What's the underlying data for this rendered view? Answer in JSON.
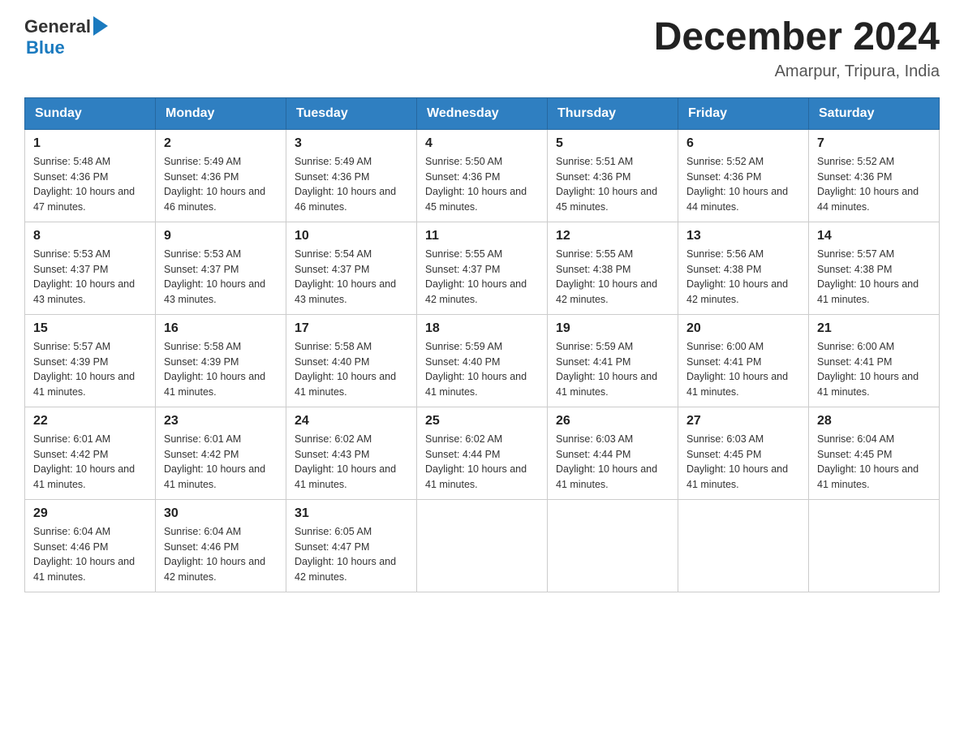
{
  "header": {
    "logo_general": "General",
    "logo_blue": "Blue",
    "month_title": "December 2024",
    "location": "Amarpur, Tripura, India"
  },
  "days_of_week": [
    "Sunday",
    "Monday",
    "Tuesday",
    "Wednesday",
    "Thursday",
    "Friday",
    "Saturday"
  ],
  "weeks": [
    [
      {
        "day": "1",
        "sunrise": "5:48 AM",
        "sunset": "4:36 PM",
        "daylight": "10 hours and 47 minutes."
      },
      {
        "day": "2",
        "sunrise": "5:49 AM",
        "sunset": "4:36 PM",
        "daylight": "10 hours and 46 minutes."
      },
      {
        "day": "3",
        "sunrise": "5:49 AM",
        "sunset": "4:36 PM",
        "daylight": "10 hours and 46 minutes."
      },
      {
        "day": "4",
        "sunrise": "5:50 AM",
        "sunset": "4:36 PM",
        "daylight": "10 hours and 45 minutes."
      },
      {
        "day": "5",
        "sunrise": "5:51 AM",
        "sunset": "4:36 PM",
        "daylight": "10 hours and 45 minutes."
      },
      {
        "day": "6",
        "sunrise": "5:52 AM",
        "sunset": "4:36 PM",
        "daylight": "10 hours and 44 minutes."
      },
      {
        "day": "7",
        "sunrise": "5:52 AM",
        "sunset": "4:36 PM",
        "daylight": "10 hours and 44 minutes."
      }
    ],
    [
      {
        "day": "8",
        "sunrise": "5:53 AM",
        "sunset": "4:37 PM",
        "daylight": "10 hours and 43 minutes."
      },
      {
        "day": "9",
        "sunrise": "5:53 AM",
        "sunset": "4:37 PM",
        "daylight": "10 hours and 43 minutes."
      },
      {
        "day": "10",
        "sunrise": "5:54 AM",
        "sunset": "4:37 PM",
        "daylight": "10 hours and 43 minutes."
      },
      {
        "day": "11",
        "sunrise": "5:55 AM",
        "sunset": "4:37 PM",
        "daylight": "10 hours and 42 minutes."
      },
      {
        "day": "12",
        "sunrise": "5:55 AM",
        "sunset": "4:38 PM",
        "daylight": "10 hours and 42 minutes."
      },
      {
        "day": "13",
        "sunrise": "5:56 AM",
        "sunset": "4:38 PM",
        "daylight": "10 hours and 42 minutes."
      },
      {
        "day": "14",
        "sunrise": "5:57 AM",
        "sunset": "4:38 PM",
        "daylight": "10 hours and 41 minutes."
      }
    ],
    [
      {
        "day": "15",
        "sunrise": "5:57 AM",
        "sunset": "4:39 PM",
        "daylight": "10 hours and 41 minutes."
      },
      {
        "day": "16",
        "sunrise": "5:58 AM",
        "sunset": "4:39 PM",
        "daylight": "10 hours and 41 minutes."
      },
      {
        "day": "17",
        "sunrise": "5:58 AM",
        "sunset": "4:40 PM",
        "daylight": "10 hours and 41 minutes."
      },
      {
        "day": "18",
        "sunrise": "5:59 AM",
        "sunset": "4:40 PM",
        "daylight": "10 hours and 41 minutes."
      },
      {
        "day": "19",
        "sunrise": "5:59 AM",
        "sunset": "4:41 PM",
        "daylight": "10 hours and 41 minutes."
      },
      {
        "day": "20",
        "sunrise": "6:00 AM",
        "sunset": "4:41 PM",
        "daylight": "10 hours and 41 minutes."
      },
      {
        "day": "21",
        "sunrise": "6:00 AM",
        "sunset": "4:41 PM",
        "daylight": "10 hours and 41 minutes."
      }
    ],
    [
      {
        "day": "22",
        "sunrise": "6:01 AM",
        "sunset": "4:42 PM",
        "daylight": "10 hours and 41 minutes."
      },
      {
        "day": "23",
        "sunrise": "6:01 AM",
        "sunset": "4:42 PM",
        "daylight": "10 hours and 41 minutes."
      },
      {
        "day": "24",
        "sunrise": "6:02 AM",
        "sunset": "4:43 PM",
        "daylight": "10 hours and 41 minutes."
      },
      {
        "day": "25",
        "sunrise": "6:02 AM",
        "sunset": "4:44 PM",
        "daylight": "10 hours and 41 minutes."
      },
      {
        "day": "26",
        "sunrise": "6:03 AM",
        "sunset": "4:44 PM",
        "daylight": "10 hours and 41 minutes."
      },
      {
        "day": "27",
        "sunrise": "6:03 AM",
        "sunset": "4:45 PM",
        "daylight": "10 hours and 41 minutes."
      },
      {
        "day": "28",
        "sunrise": "6:04 AM",
        "sunset": "4:45 PM",
        "daylight": "10 hours and 41 minutes."
      }
    ],
    [
      {
        "day": "29",
        "sunrise": "6:04 AM",
        "sunset": "4:46 PM",
        "daylight": "10 hours and 41 minutes."
      },
      {
        "day": "30",
        "sunrise": "6:04 AM",
        "sunset": "4:46 PM",
        "daylight": "10 hours and 42 minutes."
      },
      {
        "day": "31",
        "sunrise": "6:05 AM",
        "sunset": "4:47 PM",
        "daylight": "10 hours and 42 minutes."
      },
      null,
      null,
      null,
      null
    ]
  ]
}
